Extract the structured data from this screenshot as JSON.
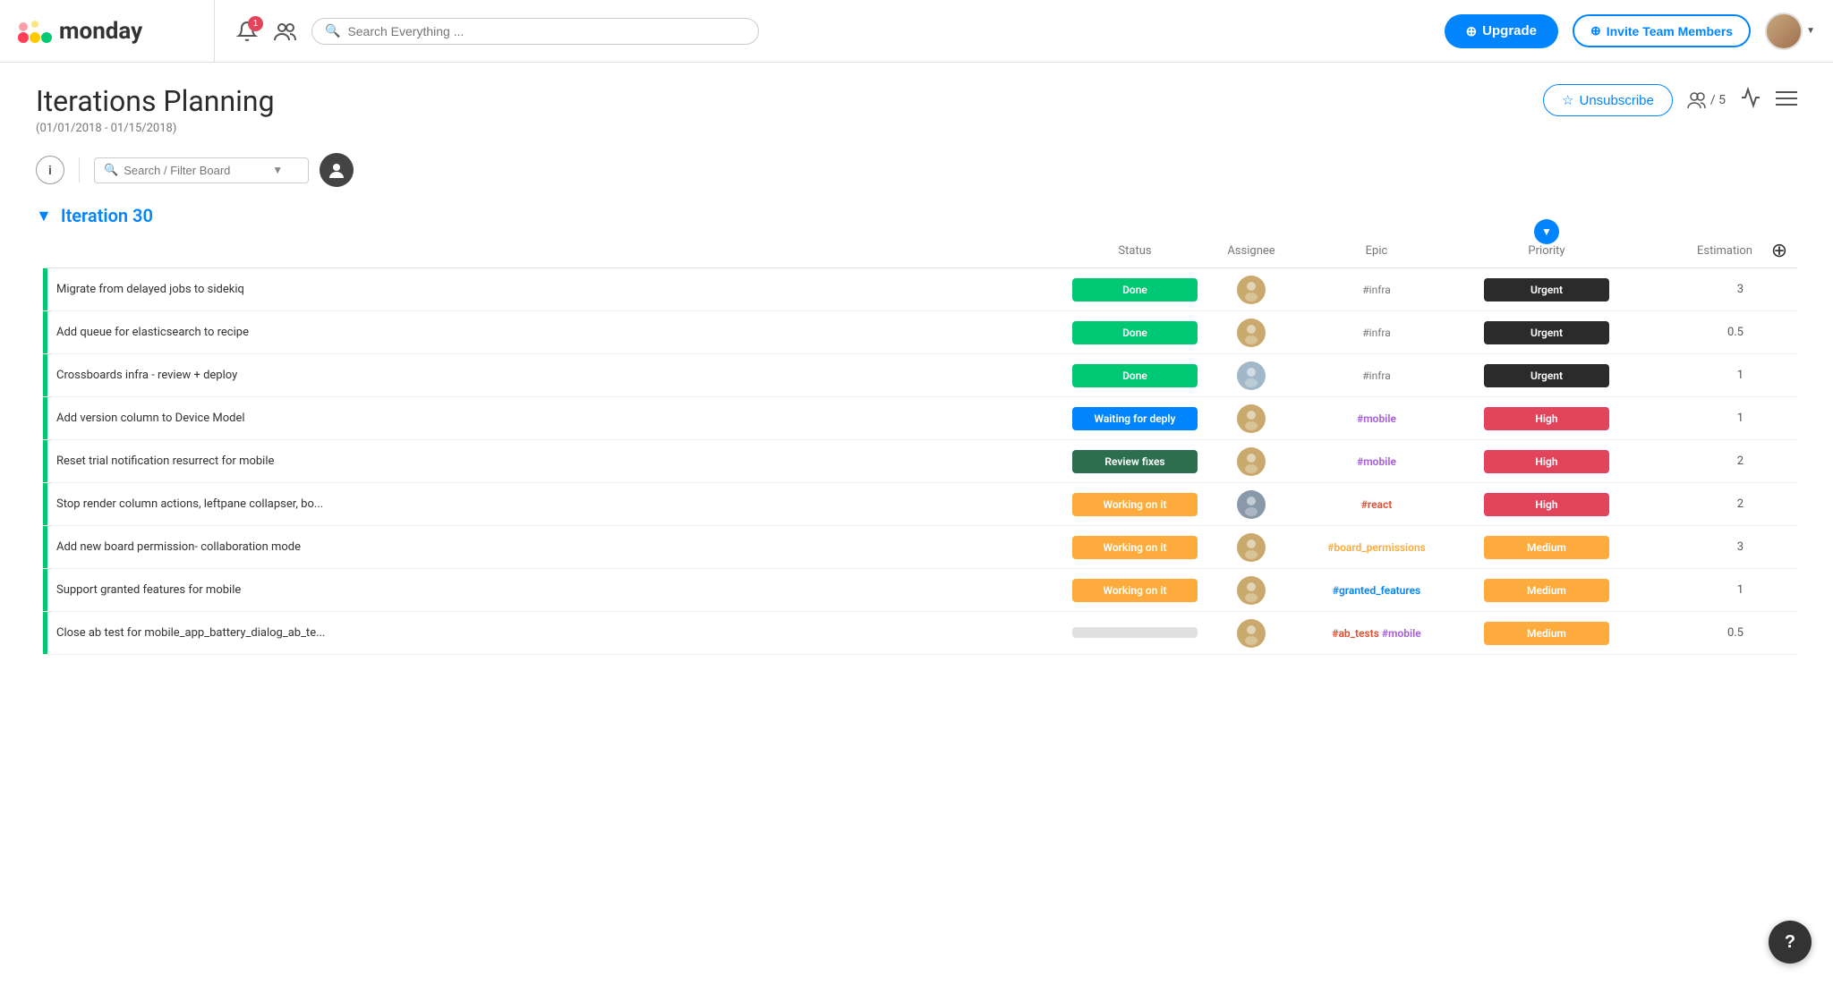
{
  "brand": {
    "name": "monday",
    "logo_colors": [
      "#ff3d57",
      "#ffcb00",
      "#00ca72"
    ]
  },
  "nav": {
    "search_placeholder": "Search Everything ...",
    "notification_count": "1",
    "upgrade_label": "Upgrade",
    "invite_label": "Invite Team Members"
  },
  "page": {
    "title": "Iterations Planning",
    "subtitle": "(01/01/2018 - 01/15/2018)",
    "unsubscribe_label": "Unsubscribe",
    "members_count": "/ 5"
  },
  "toolbar": {
    "filter_placeholder": "Search / Filter Board"
  },
  "iteration": {
    "name": "Iteration 30",
    "columns": {
      "status": "Status",
      "assignee": "Assignee",
      "epic": "Epic",
      "priority": "Priority",
      "estimation": "Estimation"
    },
    "tasks": [
      {
        "id": 1,
        "name": "Migrate from delayed jobs to sidekiq",
        "status": "Done",
        "status_class": "status-done",
        "assignee_color": "#c9a96e",
        "assignee_initials": "",
        "epic": "#infra",
        "epic_class": "epic-infra",
        "priority": "Urgent",
        "priority_class": "priority-urgent",
        "estimation": "3",
        "bar_color": "#00c875"
      },
      {
        "id": 2,
        "name": "Add queue for elasticsearch to recipe",
        "status": "Done",
        "status_class": "status-done",
        "assignee_color": "#c9a96e",
        "assignee_initials": "",
        "epic": "#infra",
        "epic_class": "epic-infra",
        "priority": "Urgent",
        "priority_class": "priority-urgent",
        "estimation": "0.5",
        "bar_color": "#00c875"
      },
      {
        "id": 3,
        "name": "Crossboards infra - review + deploy",
        "status": "Done",
        "status_class": "status-done",
        "assignee_color": "#a0b8c8",
        "assignee_initials": "",
        "epic": "#infra",
        "epic_class": "epic-infra",
        "priority": "Urgent",
        "priority_class": "priority-urgent",
        "estimation": "1",
        "bar_color": "#00c875"
      },
      {
        "id": 4,
        "name": "Add version column to Device Model",
        "status": "Waiting for deply",
        "status_class": "status-waiting",
        "assignee_color": "#c9a96e",
        "assignee_initials": "",
        "epic": "#mobile",
        "epic_class": "epic-mobile",
        "priority": "High",
        "priority_class": "priority-high",
        "estimation": "1",
        "bar_color": "#00c875"
      },
      {
        "id": 5,
        "name": "Reset trial notification resurrect for mobile",
        "status": "Review fixes",
        "status_class": "status-review",
        "assignee_color": "#c9a96e",
        "assignee_initials": "",
        "epic": "#mobile",
        "epic_class": "epic-mobile",
        "priority": "High",
        "priority_class": "priority-high",
        "estimation": "2",
        "bar_color": "#00c875"
      },
      {
        "id": 6,
        "name": "Stop render column actions, leftpane collapser, bo...",
        "status": "Working on it",
        "status_class": "status-working",
        "assignee_color": "#8899aa",
        "assignee_initials": "",
        "epic": "#react",
        "epic_class": "epic-react",
        "priority": "High",
        "priority_class": "priority-high",
        "estimation": "2",
        "bar_color": "#00c875"
      },
      {
        "id": 7,
        "name": "Add new board permission- collaboration mode",
        "status": "Working on it",
        "status_class": "status-working",
        "assignee_color": "#c9a96e",
        "assignee_initials": "",
        "epic": "#board_permissions",
        "epic_class": "epic-board",
        "priority": "Medium",
        "priority_class": "priority-medium",
        "estimation": "3",
        "bar_color": "#00c875"
      },
      {
        "id": 8,
        "name": "Support granted features for mobile",
        "status": "Working on it",
        "status_class": "status-working",
        "assignee_color": "#c9a96e",
        "assignee_initials": "",
        "epic": "#granted_features",
        "epic_class": "epic-granted",
        "priority": "Medium",
        "priority_class": "priority-medium",
        "estimation": "1",
        "bar_color": "#00c875"
      },
      {
        "id": 9,
        "name": "Close ab test for mobile_app_battery_dialog_ab_te...",
        "status": "",
        "status_class": "status-empty",
        "assignee_color": "#c9a96e",
        "assignee_initials": "",
        "epic_parts": [
          "#ab_tests",
          "#mobile"
        ],
        "epic_class": "epic-ab",
        "priority": "Medium",
        "priority_class": "priority-medium",
        "estimation": "0.5",
        "bar_color": "#00c875"
      }
    ]
  }
}
